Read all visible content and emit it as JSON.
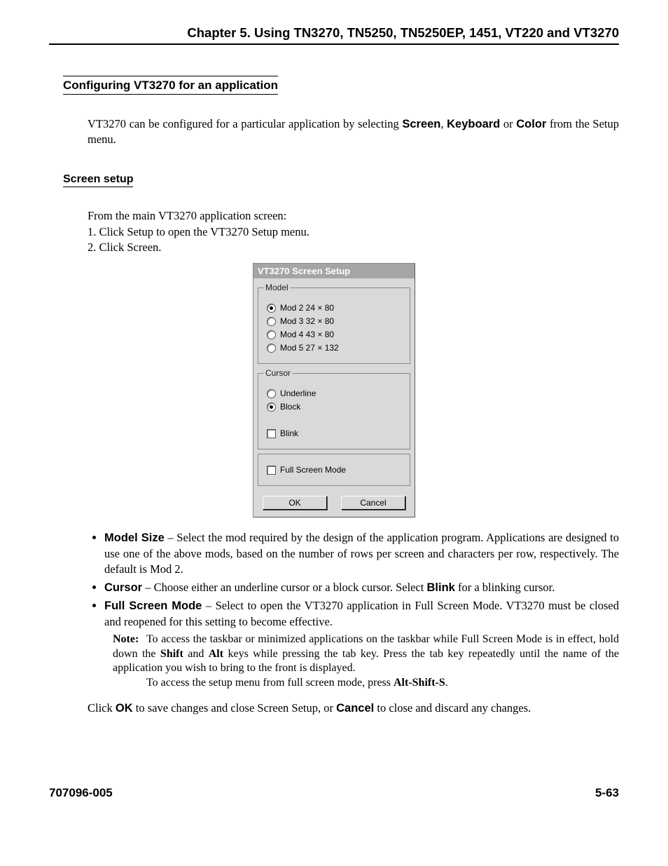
{
  "header": {
    "chapter": "Chapter 5.  Using  TN3270, TN5250, TN5250EP, 1451, VT220 and VT3270"
  },
  "section1": {
    "title": "Configuring VT3270 for an application",
    "para_a": "VT3270 can be configured for a particular application by selecting ",
    "screen": "Screen",
    "comma": ", ",
    "keyboard": "Keyboard",
    "or": " or ",
    "color": "Color",
    "para_b": " from the Setup menu."
  },
  "section2": {
    "title": "Screen setup",
    "intro": "From the main VT3270 application screen:",
    "step1_a": "1. Click ",
    "step1_b": "Setup",
    "step1_c": " to open the VT3270 Setup menu.",
    "step2_a": "2. Click ",
    "step2_b": "Screen",
    "step2_c": "."
  },
  "dialog": {
    "title": "VT3270 Screen Setup",
    "model_legend": "Model",
    "models": [
      "Mod 2 24 × 80",
      "Mod 3 32 × 80",
      "Mod 4 43 × 80",
      "Mod 5 27 × 132"
    ],
    "model_selected": 0,
    "cursor_legend": "Cursor",
    "cursor_options": [
      "Underline",
      "Block"
    ],
    "cursor_selected": 1,
    "blink_label": "Blink",
    "full_screen_label": "Full Screen Mode",
    "ok": "OK",
    "cancel": "Cancel"
  },
  "bullets": {
    "b1_label": "Model Size",
    "b1_text": " – Select the mod required by the design of the application program. Applications are designed to use one of the above mods, based on the number of rows per screen and characters per row, respectively. The default is Mod 2.",
    "b2_label": "Cursor",
    "b2_a": " – Choose either an underline cursor or a block cursor. Select ",
    "b2_blink": "Blink",
    "b2_b": " for a blinking cursor.",
    "b3_label": "Full Screen Mode",
    "b3_text": " – Select to open the VT3270 application in Full Screen Mode. VT3270 must be closed and reopened for this setting to become effective."
  },
  "note": {
    "label": "Note:",
    "line1_a": "To access the taskbar or minimized applications on the taskbar while Full Screen Mode is in effect, hold down the ",
    "shift": "Shift",
    "and": " and ",
    "alt": "Alt",
    "line1_b": " keys while pressing the tab key. Press the tab key repeatedly until the name of the application you wish to bring to the front is displayed.",
    "line2_a": "To access the setup menu from full screen mode, press ",
    "combo": "Alt-Shift-S",
    "line2_b": "."
  },
  "closing": {
    "a": "Click ",
    "ok": "OK",
    "b": " to save changes and close Screen Setup, or ",
    "cancel": "Cancel",
    "c": " to close and discard any changes."
  },
  "footer": {
    "left": "707096-005",
    "right": "5-63"
  }
}
